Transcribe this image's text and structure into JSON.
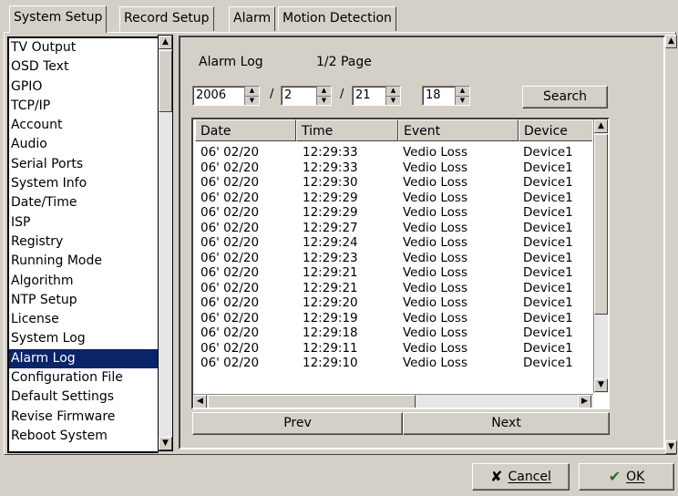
{
  "tabs": [
    {
      "label": "System Setup",
      "active": true
    },
    {
      "label": "Record Setup",
      "active": false
    },
    {
      "label": "Alarm",
      "active": false
    },
    {
      "label": "Motion Detection",
      "active": false
    }
  ],
  "sidebar": {
    "items": [
      "TV Output",
      "OSD Text",
      "GPIO",
      "TCP/IP",
      "Account",
      "Audio",
      "Serial Ports",
      "System Info",
      "Date/Time",
      "ISP",
      "Registry",
      "Running Mode",
      "Algorithm",
      "NTP Setup",
      "License",
      "System Log",
      "Alarm Log",
      "Configuration File",
      "Default Settings",
      "Revise Firmware",
      "Reboot System"
    ],
    "selected": "Alarm Log"
  },
  "alarm_log": {
    "title": "Alarm Log",
    "page_info": "1/2 Page",
    "year": "2006",
    "month": "2",
    "day": "21",
    "hour": "18",
    "sep1": "/",
    "sep2": "/",
    "search_label": "Search",
    "columns": [
      "Date",
      "Time",
      "Event",
      "Device"
    ],
    "rows": [
      [
        "06' 02/20",
        "12:29:33",
        "Vedio Loss",
        "Device1"
      ],
      [
        "06' 02/20",
        "12:29:33",
        "Vedio Loss",
        "Device1"
      ],
      [
        "06' 02/20",
        "12:29:30",
        "Vedio Loss",
        "Device1"
      ],
      [
        "06' 02/20",
        "12:29:29",
        "Vedio Loss",
        "Device1"
      ],
      [
        "06' 02/20",
        "12:29:29",
        "Vedio Loss",
        "Device1"
      ],
      [
        "06' 02/20",
        "12:29:27",
        "Vedio Loss",
        "Device1"
      ],
      [
        "06' 02/20",
        "12:29:24",
        "Vedio Loss",
        "Device1"
      ],
      [
        "06' 02/20",
        "12:29:23",
        "Vedio Loss",
        "Device1"
      ],
      [
        "06' 02/20",
        "12:29:21",
        "Vedio Loss",
        "Device1"
      ],
      [
        "06' 02/20",
        "12:29:21",
        "Vedio Loss",
        "Device1"
      ],
      [
        "06' 02/20",
        "12:29:20",
        "Vedio Loss",
        "Device1"
      ],
      [
        "06' 02/20",
        "12:29:19",
        "Vedio Loss",
        "Device1"
      ],
      [
        "06' 02/20",
        "12:29:18",
        "Vedio Loss",
        "Device1"
      ],
      [
        "06' 02/20",
        "12:29:11",
        "Vedio Loss",
        "Device1"
      ],
      [
        "06' 02/20",
        "12:29:10",
        "Vedio Loss",
        "Device1"
      ]
    ],
    "prev_label": "Prev",
    "next_label": "Next"
  },
  "footer": {
    "cancel_label": "Cancel",
    "ok_label": "OK"
  },
  "colors": {
    "selection": "#0a246a",
    "face": "#d4d0c8"
  }
}
